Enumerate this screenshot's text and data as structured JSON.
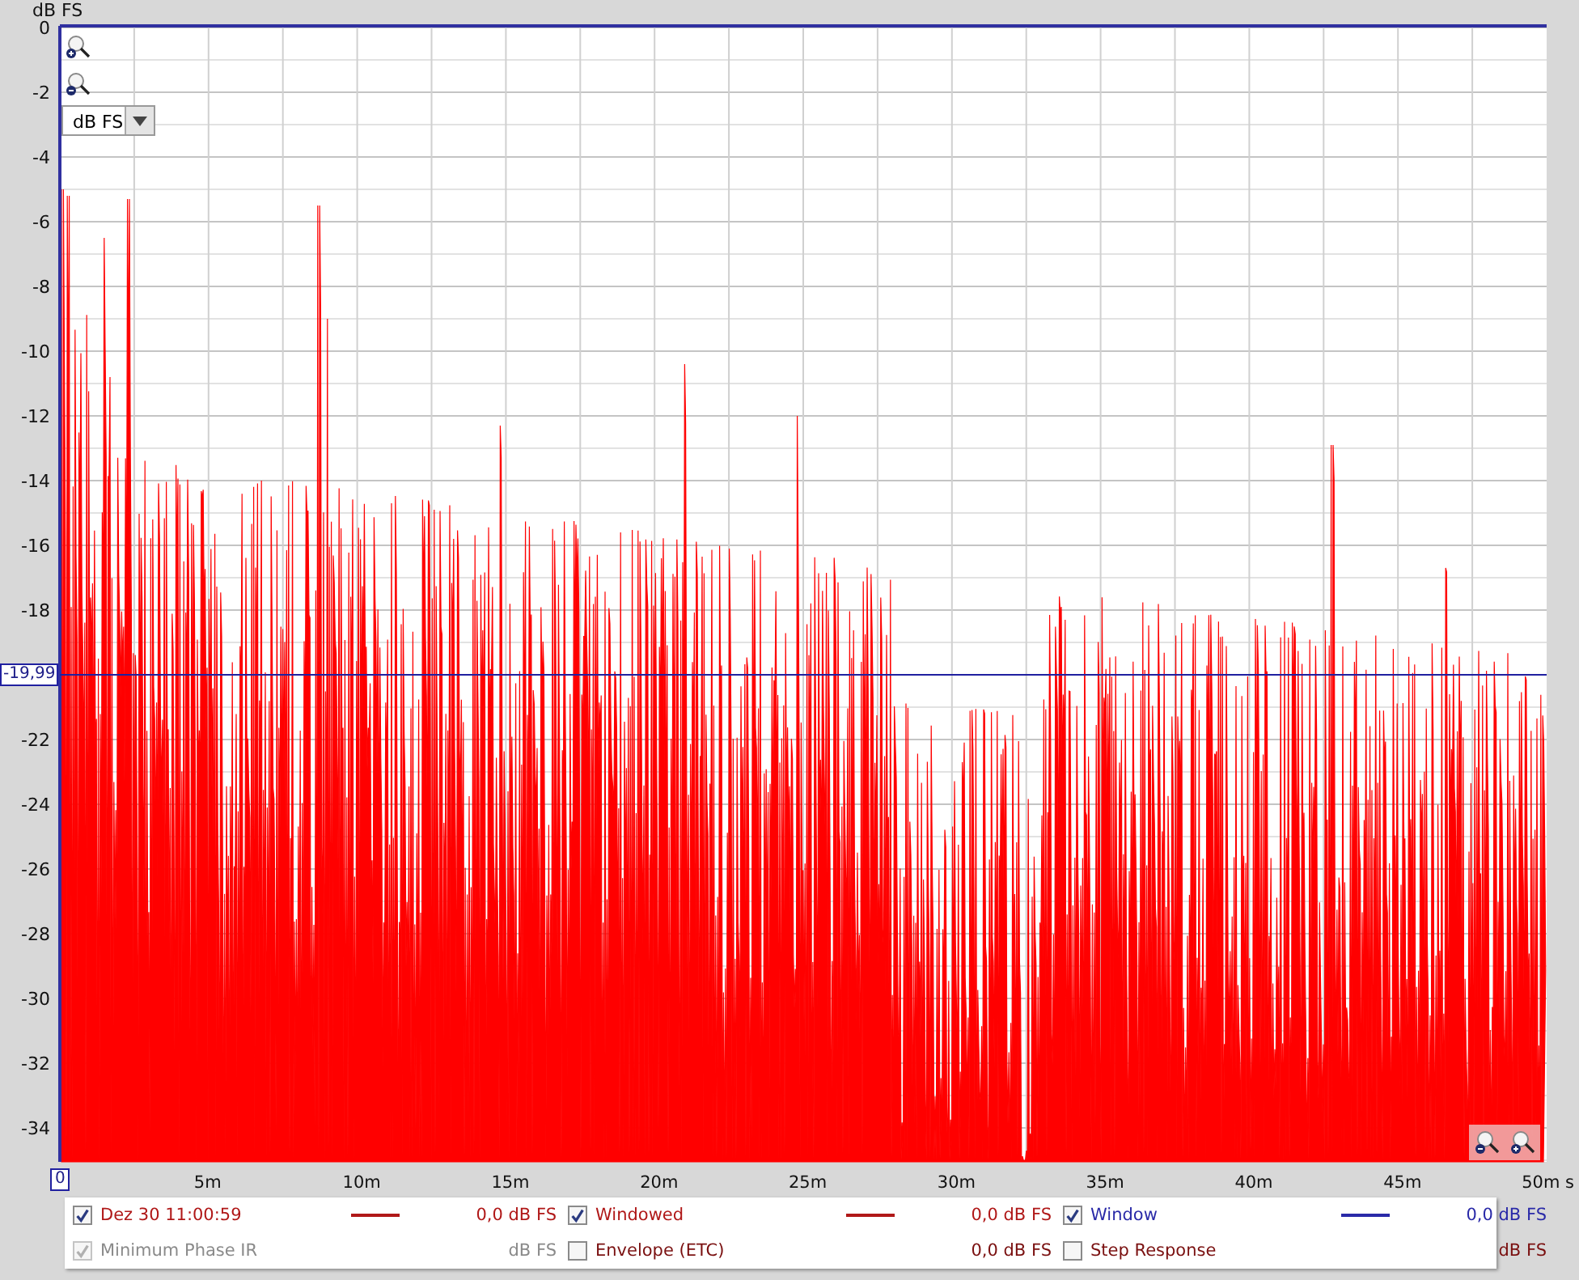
{
  "plot": {
    "y_unit": "dB FS",
    "unit_dropdown": "dB FS",
    "marker_value": "-19,99",
    "origin_label": "0",
    "y_ticks_above_marker": [
      "0",
      "-2",
      "-4",
      "-6",
      "-8",
      "-10",
      "-12",
      "-14",
      "-16",
      "-18"
    ],
    "y_ticks_below_marker": [
      "-22",
      "-24",
      "-26",
      "-28",
      "-30",
      "-32",
      "-34"
    ],
    "x_ticks": [
      "5m",
      "10m",
      "15m",
      "20m",
      "25m",
      "30m",
      "35m",
      "40m",
      "45m",
      "50m s"
    ]
  },
  "legend": [
    {
      "label": "Dez 30 11:00:59",
      "checked": true,
      "disabled": false,
      "color": "#b01818",
      "line": true,
      "value": "0,0 dB FS"
    },
    {
      "label": "Windowed",
      "checked": true,
      "disabled": false,
      "color": "#b01818",
      "line": true,
      "value": "0,0 dB FS"
    },
    {
      "label": "Window",
      "checked": true,
      "disabled": false,
      "color": "#2a2aa8",
      "line": true,
      "value": "0,0 dB FS"
    },
    {
      "label": "Minimum Phase IR",
      "checked": true,
      "disabled": true,
      "color": "#8a8a8a",
      "line": false,
      "value": "dB FS"
    },
    {
      "label": "Envelope (ETC)",
      "checked": false,
      "disabled": false,
      "color": "#7a1010",
      "line": false,
      "value": "0,0 dB FS"
    },
    {
      "label": "Step Response",
      "checked": false,
      "disabled": false,
      "color": "#7a1010",
      "line": false,
      "value": "dB FS"
    }
  ]
}
